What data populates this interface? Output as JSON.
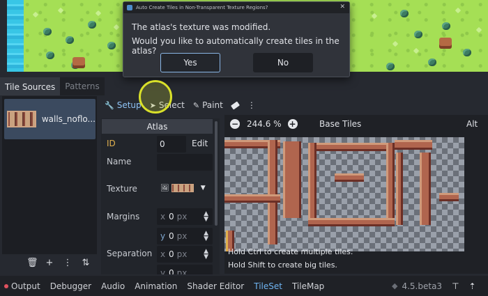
{
  "dialog": {
    "title": "Auto Create Tiles in Non-Transparent Texture Regions?",
    "message_line1": "The atlas's texture was modified.",
    "message_line2": "Would you like to automatically create tiles in the atlas?",
    "yes_label": "Yes",
    "no_label": "No",
    "close_glyph": "✕"
  },
  "tabs": [
    {
      "label": "Tile Sources",
      "active": true
    },
    {
      "label": "Patterns",
      "active": false
    }
  ],
  "sources": {
    "items": [
      {
        "name": "walls_noflo..."
      }
    ],
    "tools": [
      "🗑",
      "+",
      "⋮",
      "⇅"
    ]
  },
  "toolbar": {
    "setup_label": "Setup",
    "select_label": "Select",
    "paint_label": "Paint",
    "eraser_icon": "eraser-icon",
    "more_icon": "⋮"
  },
  "inspector": {
    "header": "Atlas",
    "id_label": "ID",
    "id_value": "0",
    "edit_label": "Edit",
    "name_label": "Name",
    "name_value": "",
    "texture_label": "Texture",
    "margins_label": "Margins",
    "margins_x_axis": "x",
    "margins_x": "0",
    "margins_y_axis": "y",
    "margins_y": "0",
    "separation_label": "Separation",
    "separation_x_axis": "x",
    "separation_x": "0",
    "separation_y_axis": "y",
    "separation_y": "0",
    "unit": "px"
  },
  "atlas": {
    "zoom_out": "−",
    "zoom_value": "244.6 %",
    "zoom_in": "+",
    "title": "Base Tiles",
    "alt_label": "Alt",
    "hint1": "Hold Ctrl to create multiple tiles.",
    "hint2": "Hold Shift to create big tiles."
  },
  "dock": {
    "tabs": [
      "Output",
      "Debugger",
      "Audio",
      "Animation",
      "Shader Editor",
      "TileSet",
      "TileMap"
    ],
    "active_tab": "TileSet",
    "version": "4.5.beta3"
  },
  "colors": {
    "accent": "#6fb4f2",
    "active_label": "#e0b04e",
    "error_dot": "#e0525f"
  }
}
